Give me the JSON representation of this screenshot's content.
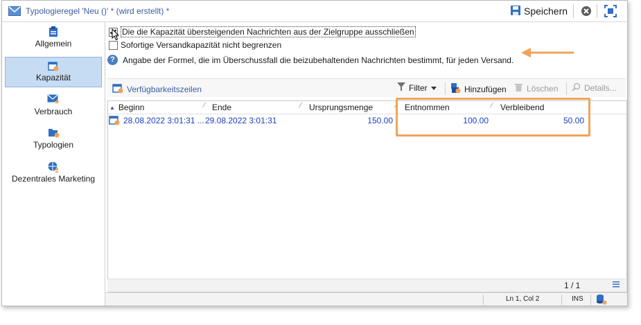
{
  "window": {
    "title": "Typologieregel 'Neu ()' * (wird erstellt) *",
    "save_label": "Speichern"
  },
  "sidebar": {
    "items": [
      {
        "label": "Allgemein",
        "icon": "clipboard-icon",
        "active": false
      },
      {
        "label": "Kapazität",
        "icon": "calendar-gear-icon",
        "active": true
      },
      {
        "label": "Verbrauch",
        "icon": "envelope-star-icon",
        "active": false
      },
      {
        "label": "Typologien",
        "icon": "folder-gear-icon",
        "active": false
      },
      {
        "label": "Dezentrales Marketing",
        "icon": "globe-user-icon",
        "active": false
      }
    ]
  },
  "options": {
    "exclude_label": "Die die Kapazität übersteigenden Nachrichten aus der Zielgruppe ausschließen",
    "exclude_checked": true,
    "no_limit_label": "Sofortige Versandkapazität nicht begrenzen",
    "no_limit_checked": false,
    "info_text": "Angabe der Formel, die im Überschussfall die beizubehaltenden Nachrichten bestimmt, für jeden Versand."
  },
  "toolbar": {
    "section_label": "Verfügbarkeitszeilen",
    "filter_label": "Filter",
    "add_label": "Hinzufügen",
    "delete_label": "Löschen",
    "details_label": "Details..."
  },
  "grid": {
    "columns": [
      "Beginn",
      "Ende",
      "Ursprungsmenge",
      "Entnommen",
      "Verbleibend"
    ],
    "rows": [
      {
        "beginn": "28.08.2022 3:01:31 ...",
        "ende": "29.08.2022 3:01:31",
        "ursprungsmenge": "150.00",
        "entnommen": "100.00",
        "verbleibend": "50.00"
      }
    ],
    "pager": "1 / 1"
  },
  "statusbar": {
    "position": "Ln 1, Col 2",
    "mode": "INS"
  },
  "colors": {
    "accent": "#3b5ca8",
    "highlight": "#f0a35a",
    "selected_bg": "#c6dcf2"
  }
}
